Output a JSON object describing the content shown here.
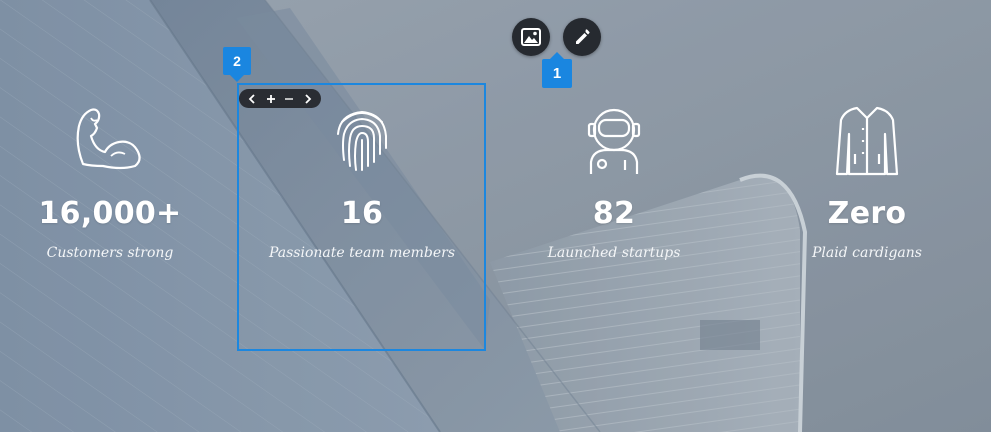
{
  "editor": {
    "badge_1": "1",
    "badge_2": "2",
    "image_button_icon": "image-icon",
    "edit_button_icon": "pencil-icon",
    "mini_toolbar": [
      "chevron-left-icon",
      "plus-icon",
      "minus-icon",
      "chevron-right-icon"
    ]
  },
  "stats": [
    {
      "icon": "flexed-arm-icon",
      "value": "16,000+",
      "label": "Customers strong"
    },
    {
      "icon": "fingerprint-icon",
      "value": "16",
      "label": "Passionate team members"
    },
    {
      "icon": "astronaut-icon",
      "value": "82",
      "label": "Launched startups"
    },
    {
      "icon": "cardigan-icon",
      "value": "Zero",
      "label": "Plaid cardigans"
    }
  ],
  "colors": {
    "accent": "#1a86e0",
    "control_dark": "#262a30",
    "text": "#ffffff"
  }
}
